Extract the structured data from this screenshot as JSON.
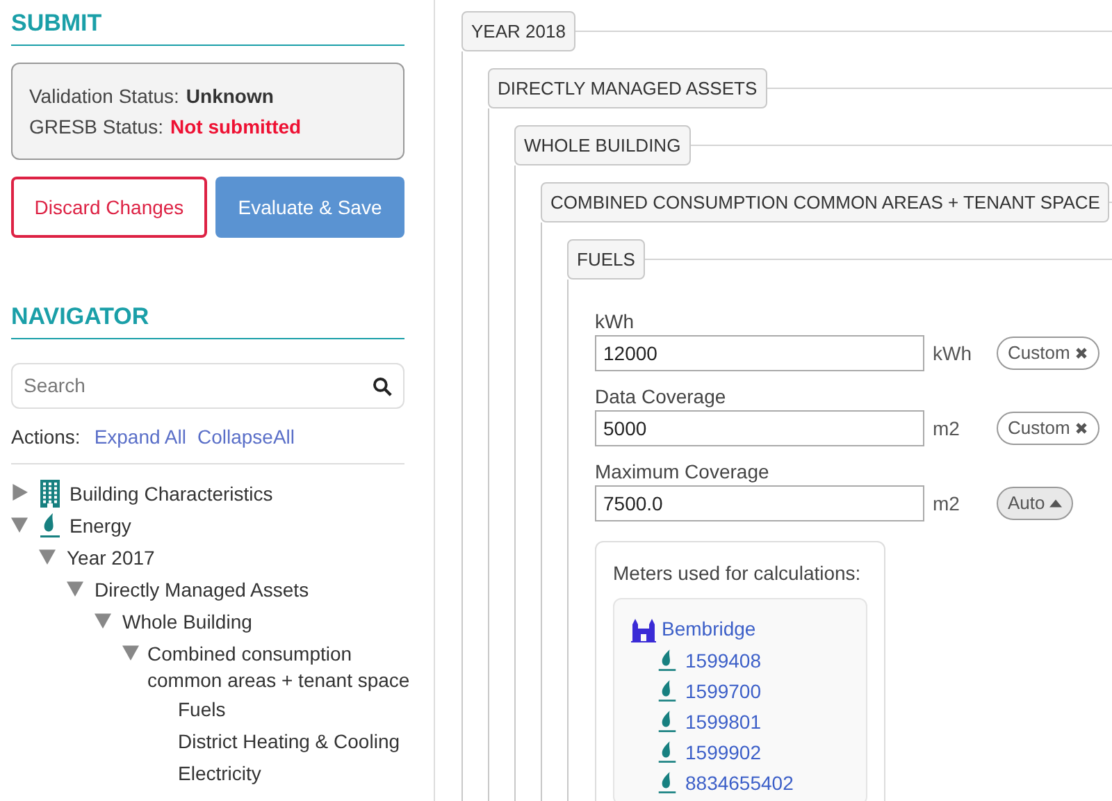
{
  "submit": {
    "title": "SUBMIT",
    "statuses": [
      {
        "label": "Validation Status:",
        "value": "Unknown",
        "kind": "neutral"
      },
      {
        "label": "GRESB Status:",
        "value": "Not submitted",
        "kind": "alert"
      }
    ],
    "buttons": [
      {
        "label": "Discard Changes",
        "kind": "outline"
      },
      {
        "label": "Evaluate & Save",
        "kind": "primary"
      }
    ]
  },
  "navigator": {
    "title": "NAVIGATOR",
    "search": {
      "placeholder": "Search"
    },
    "actions_label": "Actions:",
    "actions": [
      "Expand All",
      "CollapseAll"
    ],
    "tree": [
      {
        "label": "Building Characteristics",
        "kind": "building",
        "expanded": false
      },
      {
        "label": "Energy",
        "kind": "flame",
        "expanded": true,
        "children": [
          {
            "label": "Year 2017",
            "expanded": true,
            "children": [
              {
                "label": "Directly Managed Assets",
                "expanded": true,
                "children": [
                  {
                    "label": "Whole Building",
                    "expanded": true,
                    "children": [
                      {
                        "label": "Combined consumption common areas + tenant space",
                        "expanded": true,
                        "children": [
                          {
                            "label": "Fuels"
                          },
                          {
                            "label": "District Heating & Cooling"
                          },
                          {
                            "label": "Electricity"
                          }
                        ]
                      }
                    ]
                  }
                ]
              }
            ]
          }
        ]
      }
    ]
  },
  "sections": {
    "title": "YEAR 2018",
    "child": {
      "title": "DIRECTLY MANAGED ASSETS",
      "child": {
        "title": "WHOLE BUILDING",
        "child": {
          "title": "COMBINED CONSUMPTION COMMON AREAS + TENANT SPACE",
          "child": {
            "title": "FUELS"
          }
        }
      }
    }
  },
  "fields": [
    {
      "label": "kWh",
      "value": "12000",
      "unit": "kWh",
      "mode": {
        "label": "Custom",
        "kind": "custom"
      }
    },
    {
      "label": "Data Coverage",
      "value": "5000",
      "unit": "m2",
      "mode": {
        "label": "Custom",
        "kind": "custom"
      }
    },
    {
      "label": "Maximum Coverage",
      "value": "7500.0",
      "unit": "m2",
      "mode": {
        "label": "Auto",
        "kind": "auto"
      }
    }
  ],
  "meters": {
    "title": "Meters used for calculations:",
    "site": "Bembridge",
    "items": [
      "1599408",
      "1599700",
      "1599801",
      "1599902",
      "8834655402"
    ]
  }
}
